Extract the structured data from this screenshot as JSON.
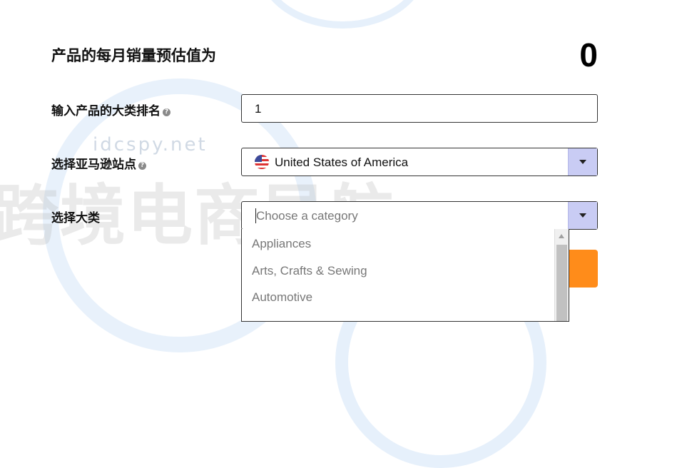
{
  "watermark": {
    "site": "idcspy.net",
    "brand": "跨境电商导航"
  },
  "result": {
    "heading": "产品的每月销量预估值为",
    "value": "0"
  },
  "rank": {
    "label": "输入产品的大类排名",
    "help": "?",
    "value": "1"
  },
  "marketplace": {
    "label": "选择亚马逊站点",
    "help": "?",
    "selected": "United States of America",
    "flag_icon": "us-flag-icon"
  },
  "category": {
    "label": "选择大类",
    "placeholder": "Choose a category",
    "options": [
      "Appliances",
      "Arts, Crafts & Sewing",
      "Automotive"
    ]
  },
  "colors": {
    "accent_orange": "#ff8c1a",
    "select_arrow_bg": "#c9ccf4"
  }
}
